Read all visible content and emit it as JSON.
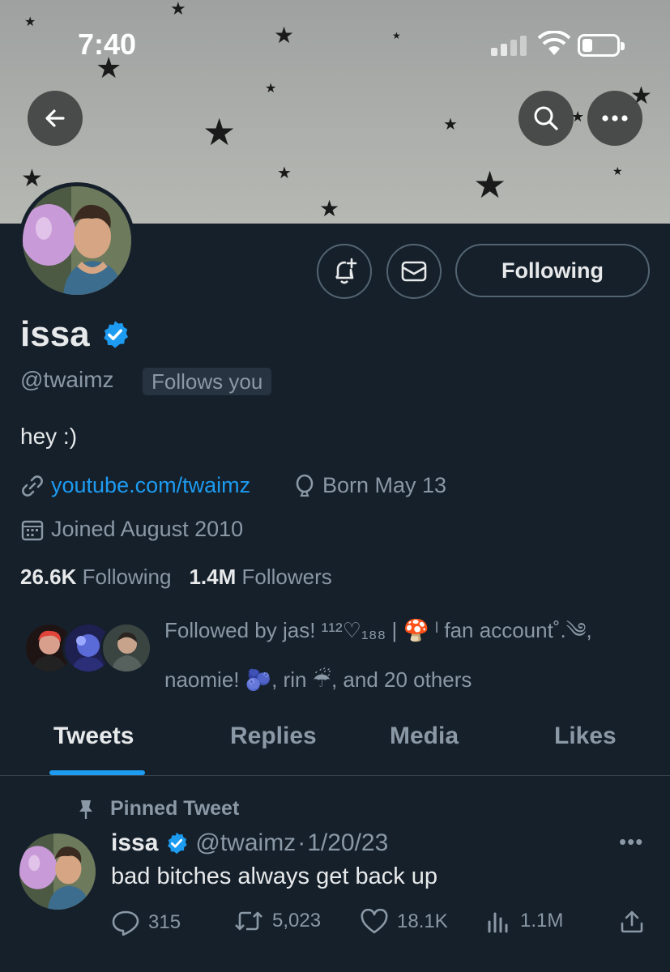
{
  "status_bar": {
    "time": "7:40"
  },
  "profile": {
    "name": "issa",
    "handle": "@twaimz",
    "follows_you": "Follows you",
    "bio": "hey :)",
    "website": "youtube.com/twaimz",
    "birthday": "Born May 13",
    "joined": "Joined August 2010",
    "following_count": "26.6K",
    "following_label": "Following",
    "followers_count": "1.4M",
    "followers_label": "Followers",
    "follow_button": "Following",
    "followed_by_line1": "Followed by jas! ¹¹²♡₁₈₈ | 🍄 ˡ fan account˚.༄,",
    "followed_by_line2": "naomie! 🫐, rin ☔, and 20 others"
  },
  "tabs": [
    "Tweets",
    "Replies",
    "Media",
    "Likes"
  ],
  "pinned_tweet": {
    "label": "Pinned Tweet",
    "name": "issa",
    "handle": "@twaimz",
    "separator": "·",
    "date": "1/20/23",
    "text": "bad bitches always get back up",
    "replies": "315",
    "retweets": "5,023",
    "likes": "18.1K",
    "views": "1.1M"
  },
  "colors": {
    "background": "#15202b",
    "accent": "#1d9bf0",
    "muted": "#8b98a5"
  }
}
